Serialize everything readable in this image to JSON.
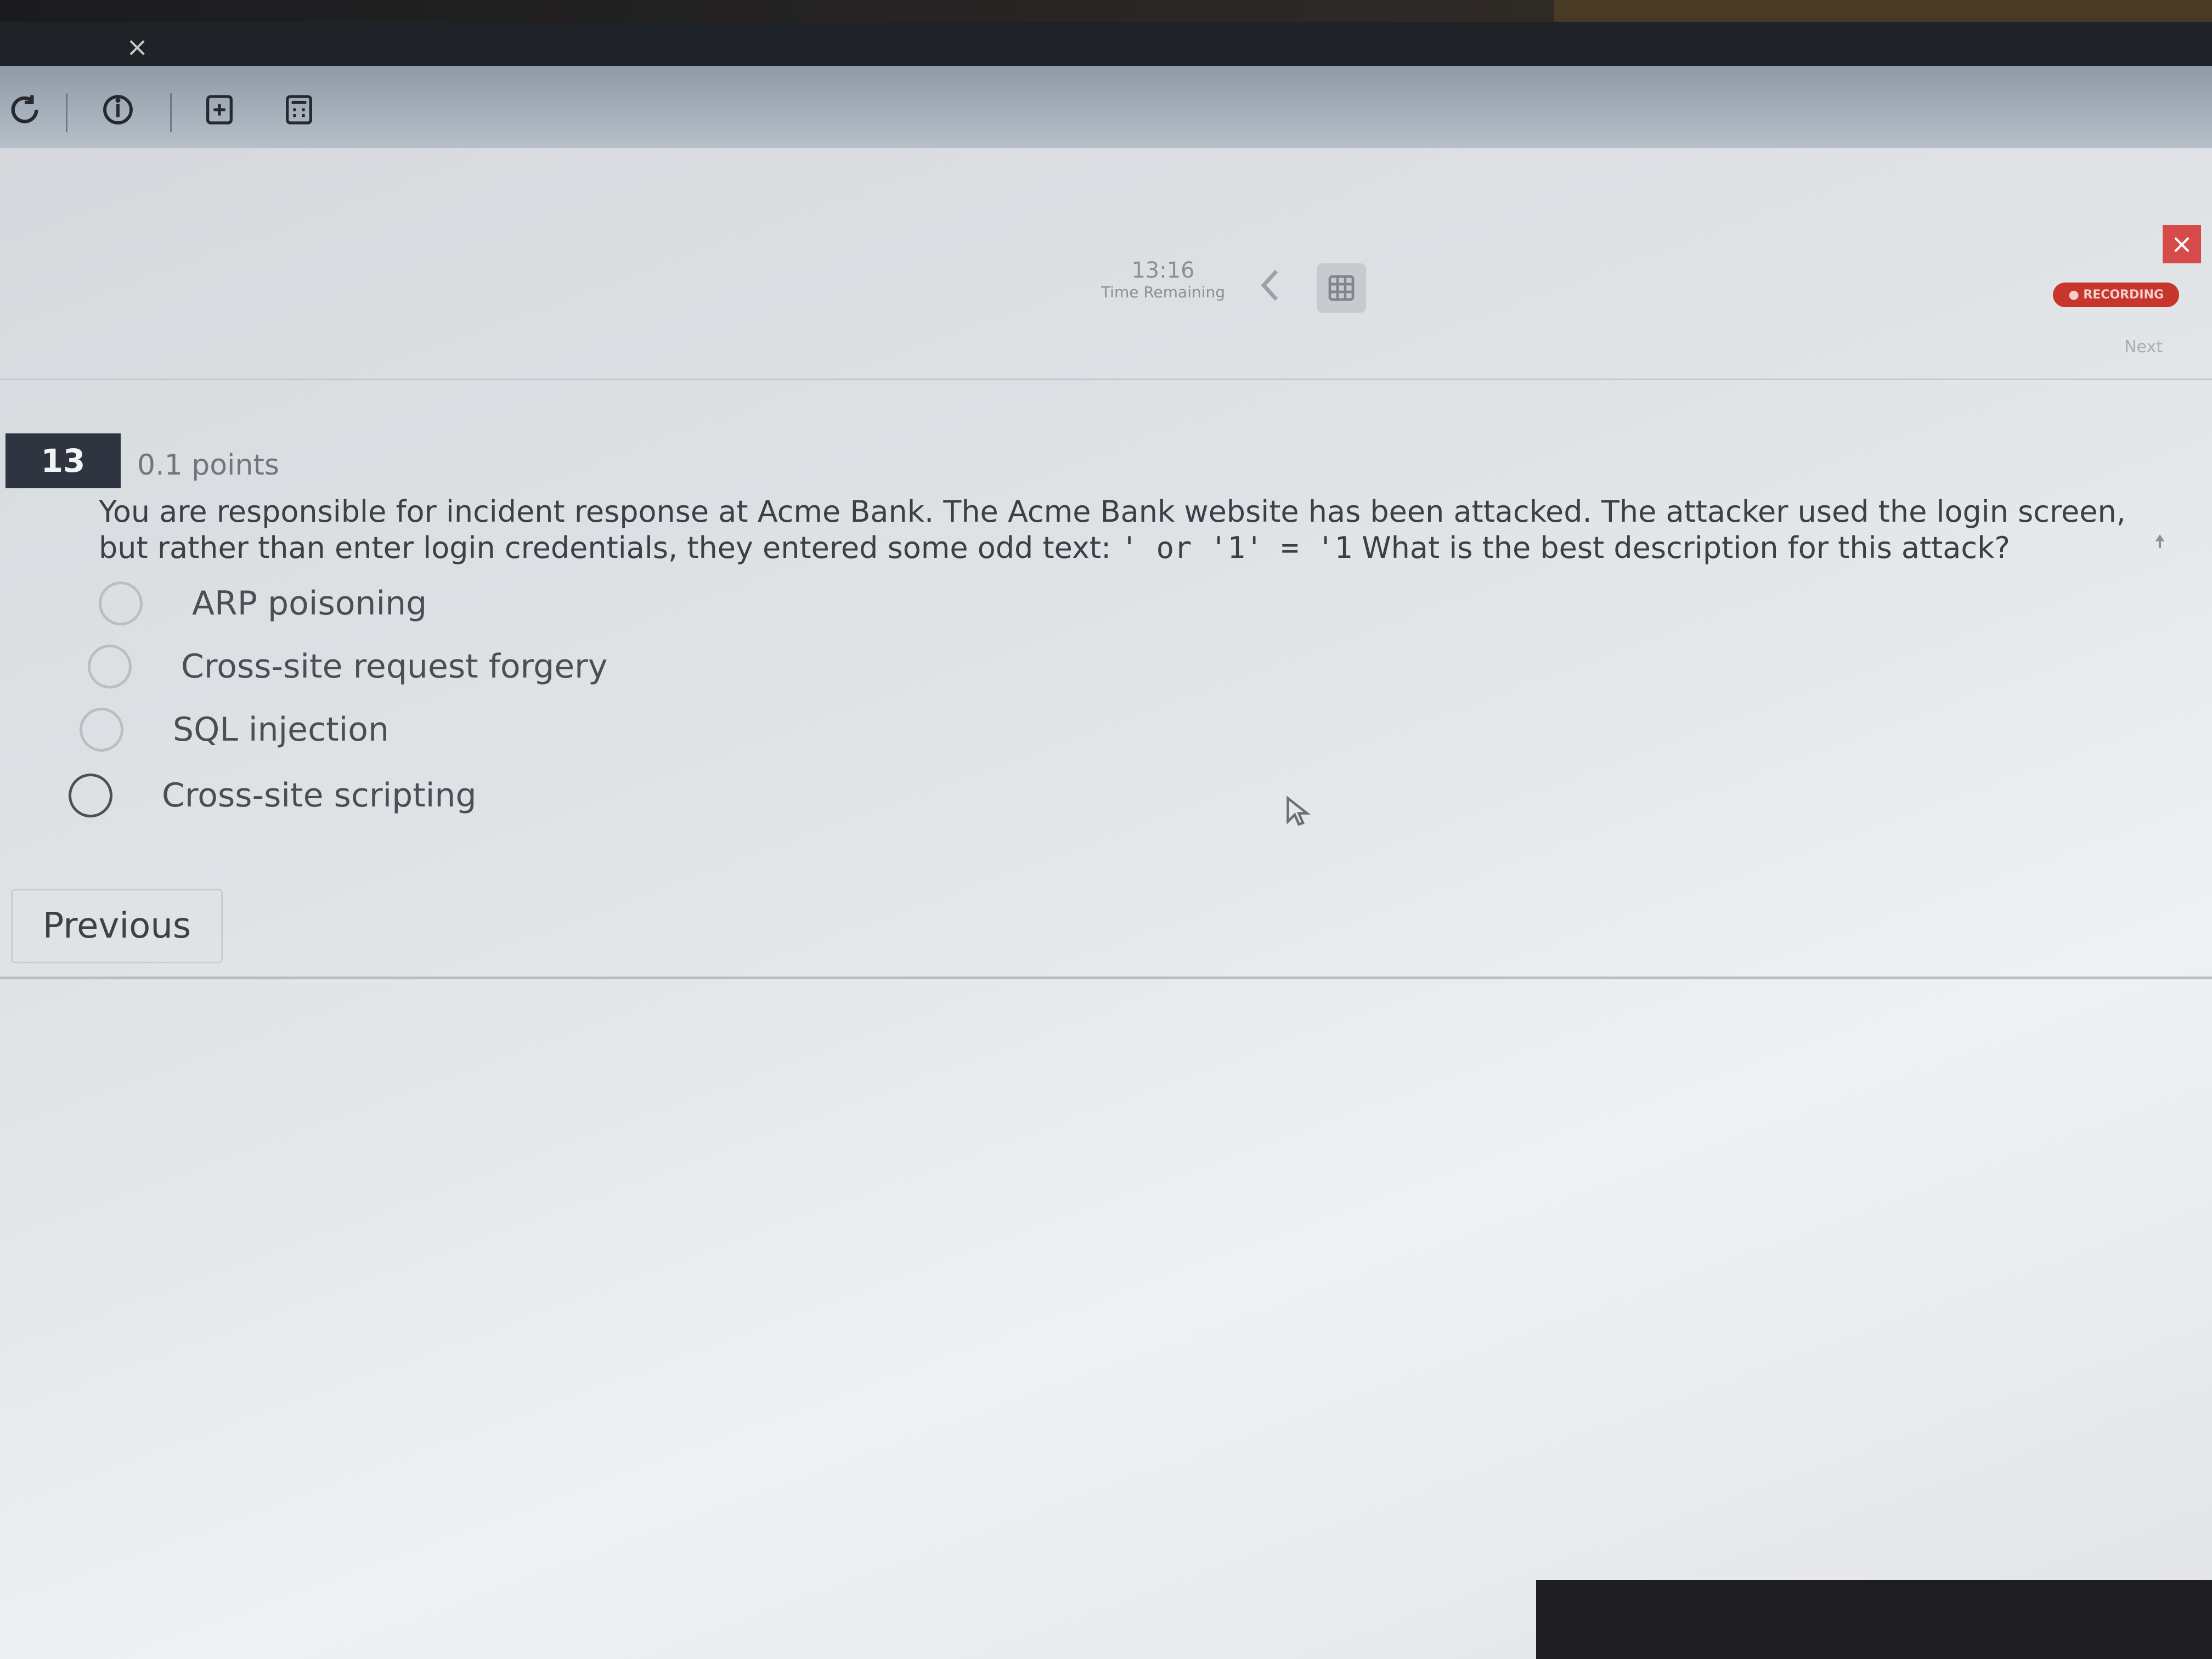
{
  "browser": {
    "tab_close_glyph": "×",
    "toolbar_icons": [
      "reload-icon",
      "info-icon",
      "new-document-icon",
      "calculator-icon"
    ]
  },
  "exam_header": {
    "timer_value": "13:16",
    "timer_label": "Time Remaining",
    "record_badge": "● RECORDING",
    "next_label": "Next",
    "close_glyph": "×"
  },
  "question": {
    "number": "13",
    "points": "0.1 points",
    "text_part1": "You are responsible for incident response at Acme Bank. The Acme Bank website has been attacked. The attacker used the login screen, but rather than enter login credentials, they entered some odd text: ",
    "text_code": "' or '1' = '1",
    "text_part2": "What is the best description for this attack?",
    "options": [
      {
        "label": "ARP poisoning",
        "selected": false
      },
      {
        "label": "Cross-site request forgery",
        "selected": false
      },
      {
        "label": "SQL injection",
        "selected": false
      },
      {
        "label": "Cross-site scripting",
        "selected": false
      }
    ]
  },
  "navigation": {
    "previous_label": "Previous"
  },
  "colors": {
    "question_badge": "#2f3540",
    "record_badge": "#c8352d",
    "close_button": "#d64a4a"
  }
}
